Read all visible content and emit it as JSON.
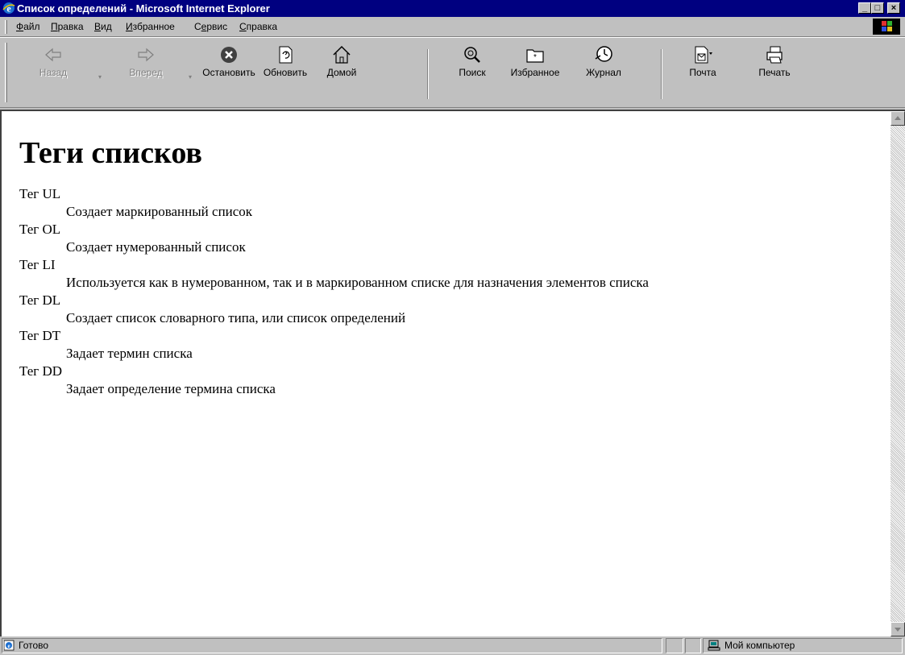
{
  "window": {
    "title": "Список определений - Microsoft Internet Explorer",
    "controls": {
      "minimize": "_",
      "maximize": "□",
      "close": "×"
    }
  },
  "menu": {
    "items": [
      {
        "u": "Ф",
        "rest": "айл"
      },
      {
        "u": "П",
        "rest": "равка"
      },
      {
        "u": "В",
        "rest": "ид"
      },
      {
        "u": "И",
        "rest": "збранное"
      },
      {
        "pre": "С",
        "u": "е",
        "rest": "рвис"
      },
      {
        "u": "С",
        "rest": "правка"
      }
    ]
  },
  "toolbar": {
    "back": "Назад",
    "forward": "Вперед",
    "stop": "Остановить",
    "refresh": "Обновить",
    "home": "Домой",
    "search": "Поиск",
    "favorites": "Избранное",
    "history": "Журнал",
    "mail": "Почта",
    "print": "Печать",
    "dropdown_glyph": "▾"
  },
  "page": {
    "heading": "Теги списков",
    "definitions": [
      {
        "term": "Тег UL",
        "desc": "Создает маркированный список"
      },
      {
        "term": "Тег OL",
        "desc": "Создает нумерованный список"
      },
      {
        "term": "Тег LI",
        "desc": "Используется как в нумерованном, так и в маркированном списке для назначения элементов списка"
      },
      {
        "term": "Тег DL",
        "desc": "Создает список словарного типа, или список определений"
      },
      {
        "term": "Тег DT",
        "desc": "Задает термин списка"
      },
      {
        "term": "Тег DD",
        "desc": "Задает определение термина списка"
      }
    ]
  },
  "status": {
    "text": "Готово",
    "zone": "Мой компьютер"
  }
}
